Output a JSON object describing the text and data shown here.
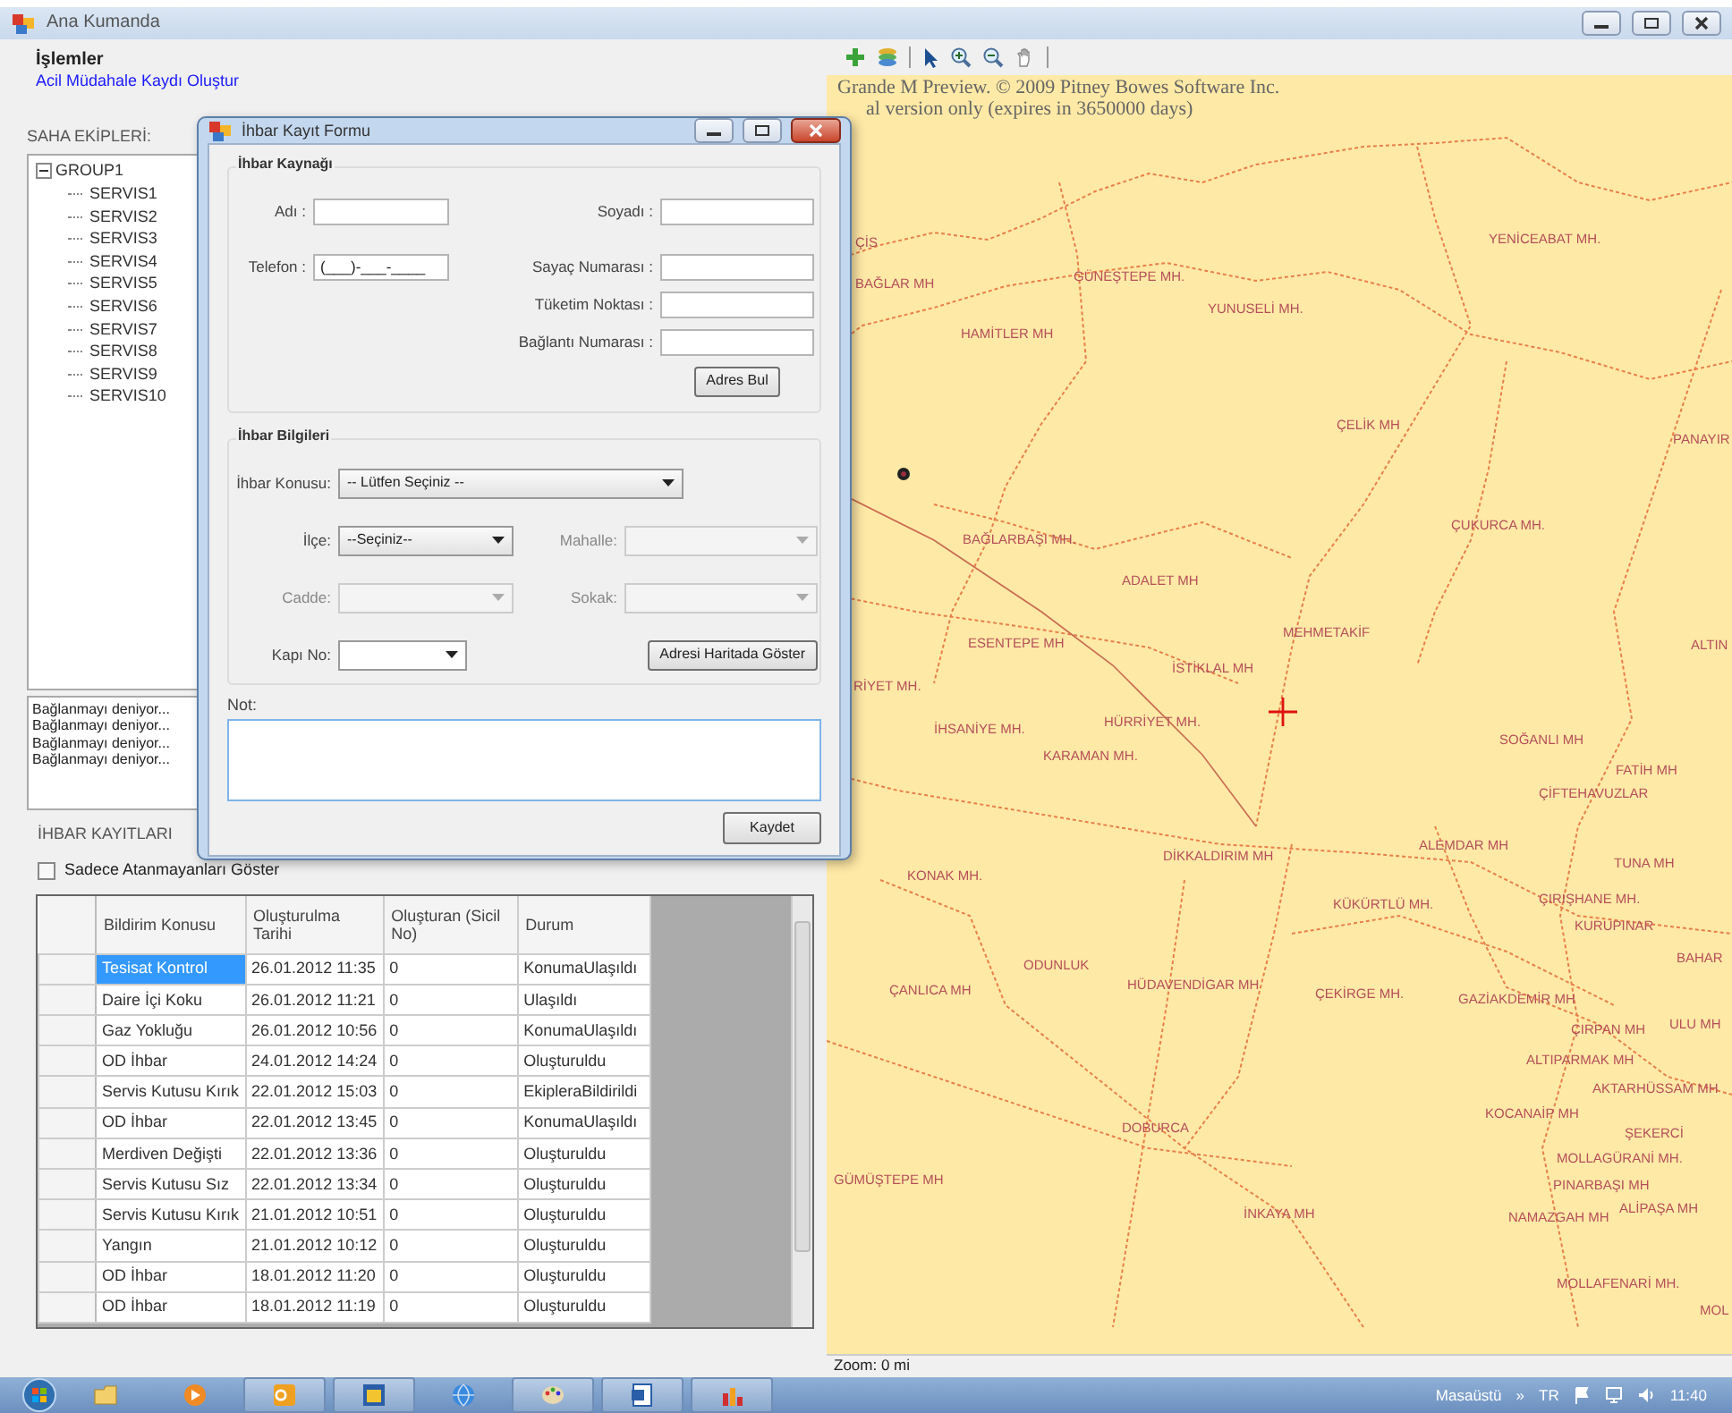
{
  "window": {
    "title": "Ana Kumanda"
  },
  "left_panel": {
    "actions_title": "İşlemler",
    "action_link": "Acil Müdahale Kaydı Oluştur",
    "teams_label": "SAHA EKİPLERİ:",
    "tree": [
      {
        "label": "GROUP1",
        "expanded": true,
        "children": [
          {
            "label": "SERVIS1"
          },
          {
            "label": "SERVIS2"
          },
          {
            "label": "SERVIS3"
          },
          {
            "label": "SERVIS4"
          },
          {
            "label": "SERVIS5"
          },
          {
            "label": "SERVIS6"
          },
          {
            "label": "SERVIS7"
          },
          {
            "label": "SERVIS8"
          },
          {
            "label": "SERVIS9"
          },
          {
            "label": "SERVIS10"
          }
        ]
      }
    ],
    "log": [
      "Bağlanmayı deniyor...",
      "Bağlanmayı deniyor...",
      "Bağlanmayı deniyor...",
      "Bağlanmayı deniyor..."
    ],
    "records_label": "İHBAR KAYITLARI",
    "filter": {
      "label": "Sadece Atanmayanları Göster",
      "checked": false
    }
  },
  "records_table": {
    "columns": [
      "Bildirim Konusu",
      "Oluşturulma Tarihi",
      "Oluşturan (Sicil No)",
      "Durum"
    ],
    "rows": [
      {
        "cells": [
          "Tesisat Kontrol",
          "26.01.2012 11:35",
          "0",
          "KonumaUlaşıldı"
        ],
        "selected": true
      },
      {
        "cells": [
          "Daire İçi Koku",
          "26.01.2012 11:21",
          "0",
          "Ulaşıldı"
        ],
        "selected": false
      },
      {
        "cells": [
          "Gaz Yokluğu",
          "26.01.2012 10:56",
          "0",
          "KonumaUlaşıldı"
        ],
        "selected": false
      },
      {
        "cells": [
          "OD İhbar",
          "24.01.2012 14:24",
          "0",
          "Oluşturuldu"
        ],
        "selected": false
      },
      {
        "cells": [
          "Servis Kutusu Kırık",
          "22.01.2012 15:03",
          "0",
          "EkipleraBildirildi"
        ],
        "selected": false
      },
      {
        "cells": [
          "OD İhbar",
          "22.01.2012 13:45",
          "0",
          "KonumaUlaşıldı"
        ],
        "selected": false
      },
      {
        "cells": [
          "Merdiven Değişti",
          "22.01.2012 13:36",
          "0",
          "Oluşturuldu"
        ],
        "selected": false
      },
      {
        "cells": [
          "Servis Kutusu Sız",
          "22.01.2012 13:34",
          "0",
          "Oluşturuldu"
        ],
        "selected": false
      },
      {
        "cells": [
          "Servis Kutusu Kırık",
          "21.01.2012 10:51",
          "0",
          "Oluşturuldu"
        ],
        "selected": false
      },
      {
        "cells": [
          "Yangın",
          "21.01.2012 10:12",
          "0",
          "Oluşturuldu"
        ],
        "selected": false
      },
      {
        "cells": [
          "OD İhbar",
          "18.01.2012 11:20",
          "0",
          "Oluşturuldu"
        ],
        "selected": false
      },
      {
        "cells": [
          "OD İhbar",
          "18.01.2012 11:19",
          "0",
          "Oluşturuldu"
        ],
        "selected": false
      }
    ]
  },
  "dialog": {
    "title": "İhbar Kayıt Formu",
    "source_group": {
      "title": "İhbar Kaynağı",
      "fields": [
        {
          "label": "Adı :"
        },
        {
          "label": "Soyadı :"
        },
        {
          "label": "Telefon :",
          "value": "(___)-___-____"
        },
        {
          "label": "Sayaç Numarası :"
        },
        {
          "label": "Tüketim Noktası :"
        },
        {
          "label": "Bağlantı Numarası :"
        }
      ],
      "button": "Adres Bul"
    },
    "info_group": {
      "title": "İhbar Bilgileri",
      "fields": [
        {
          "label": "İhbar Konusu:",
          "kind": "select",
          "value": "-- Lütfen Seçiniz --",
          "disabled": false
        },
        {
          "label": "İlçe:",
          "kind": "select",
          "value": "--Seçiniz--",
          "disabled": false
        },
        {
          "label": "Mahalle:",
          "kind": "select",
          "disabled": true
        },
        {
          "label": "Cadde:",
          "kind": "select",
          "disabled": true
        },
        {
          "label": "Sokak:",
          "kind": "select",
          "disabled": true
        },
        {
          "label": "Kapı No:",
          "kind": "combo",
          "disabled": false
        }
      ],
      "button": "Adresi Haritada Göster"
    },
    "note_label": "Not:",
    "save_button": "Kaydet"
  },
  "map": {
    "trial_notice": [
      "Grande M Preview. © 2009 Pitney Bowes Software Inc.",
      "al version only  (expires in 3650000 days)"
    ],
    "labels": [
      "ÇİS",
      "BAĞLAR MH",
      "GÜNEŞTEPE MH.",
      "YUNUSELİ MH.",
      "HAMİTLER MH",
      "YENİCEABAT MH.",
      "ÇELİK MH",
      "PANAYIR",
      "BAĞLARBAŞI MH.",
      "ÇUKURCA MH.",
      "ADALET MH",
      "MEHMETAKİF",
      "ALTIN",
      "ESENTEPE MH",
      "İSTİKLAL MH",
      "RİYET MH.",
      "HÜRRİYET MH.",
      "İHSANİYE MH.",
      "KARAMAN MH.",
      "SOĞANLI MH",
      "FATİH MH",
      "ÇİFTEHAVUZLAR",
      "ALEMDAR MH",
      "DİKKALDIRIM MH",
      "TUNA MH",
      "KONAK MH.",
      "KÜKÜRTLÜ MH.",
      "ÇIRIŞHANE MH.",
      "KURUPINAR",
      "BAHAR",
      "ODUNLUK",
      "ÇANLICA MH",
      "HÜDAVENDİGAR MH",
      "ÇEKİRGE MH.",
      "GAZİAKDEMİR MH",
      "ÇIRPAN MH",
      "ULU MH",
      "ALTIPARMAK MH",
      "AKTARHÜSSAM MH",
      "KOCANAİP MH",
      "ŞEKERCİ",
      "MOLLAGÜRANİ MH.",
      "PINARBAŞI MH",
      "ALİPAŞA MH",
      "NAMAZGAH MH",
      "DOBURCA",
      "GÜMÜŞTEPE MH",
      "İNKAYA MH",
      "MOLLAFENARİ MH.",
      "MOL"
    ],
    "status": "Zoom: 0 mi"
  },
  "taskbar": {
    "desktop_label": "Masaüstü",
    "chevron": "»",
    "language": "TR",
    "clock": "11:40"
  }
}
